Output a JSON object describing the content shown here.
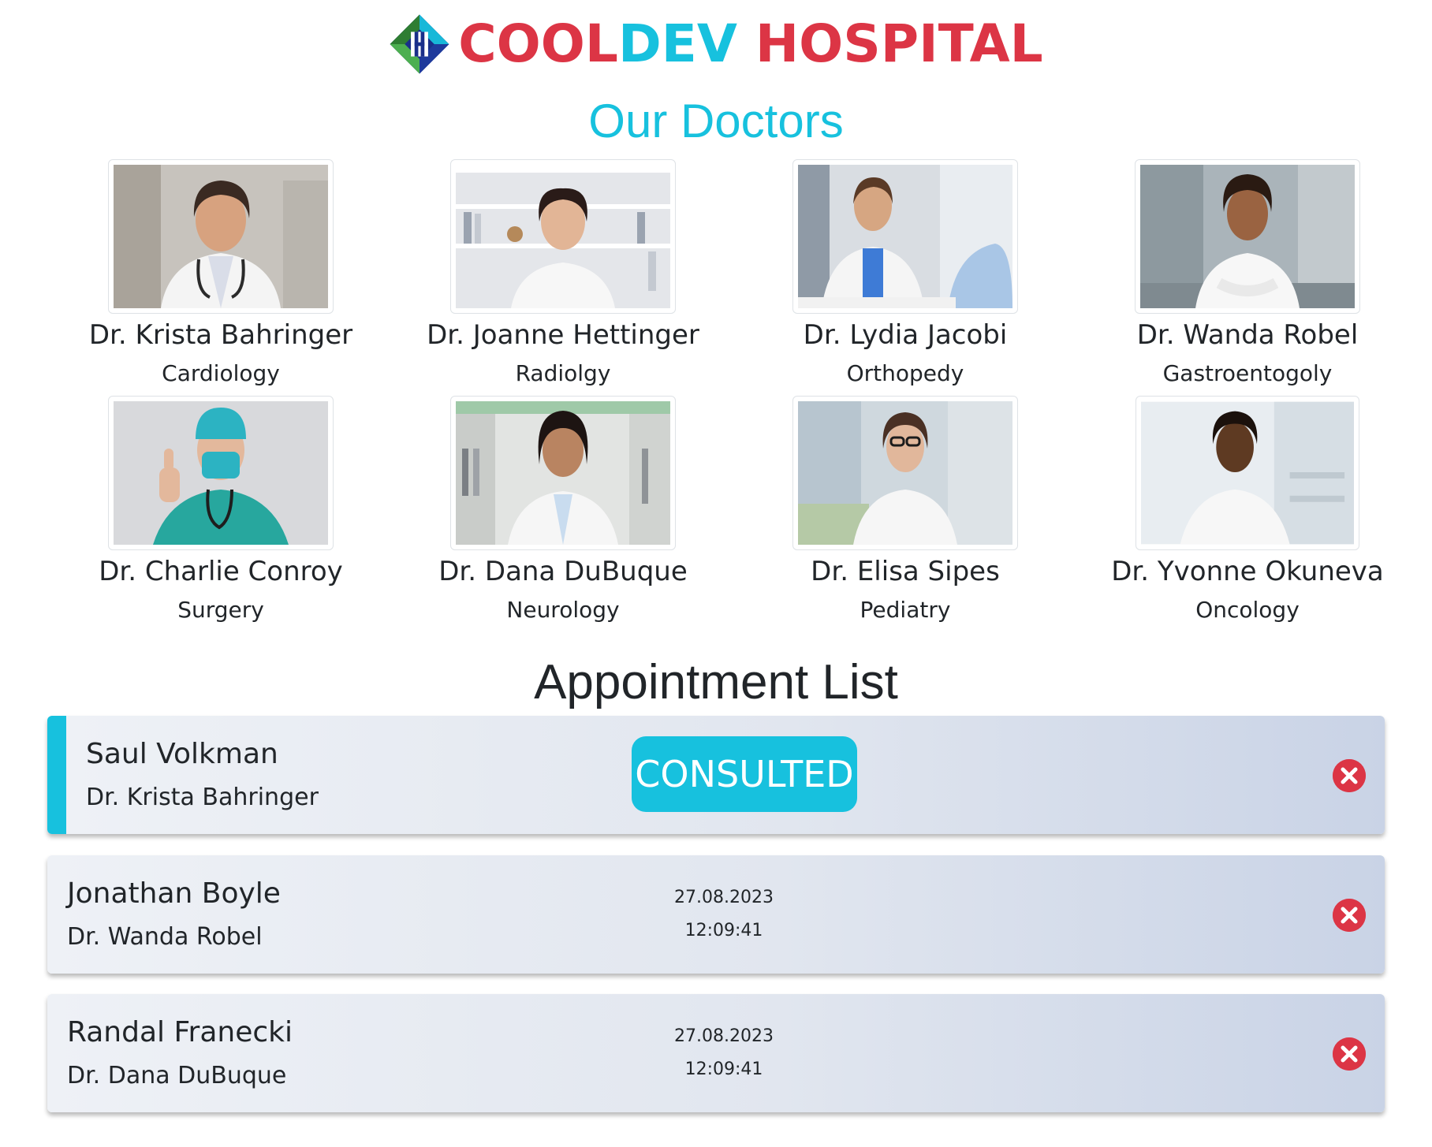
{
  "brand": {
    "part1": "COOL",
    "part2": "DEV",
    "part3": " HOSPITAL",
    "logo_icon": "hospital-logo-icon",
    "colors": {
      "red": "#dc3545",
      "cyan": "#17c1de"
    }
  },
  "doctors_section": {
    "title": "Our Doctors",
    "doctors": [
      {
        "name": "Dr. Krista Bahringer",
        "specialty": "Cardiology"
      },
      {
        "name": "Dr. Joanne Hettinger",
        "specialty": "Radiolgy"
      },
      {
        "name": "Dr. Lydia Jacobi",
        "specialty": "Orthopedy"
      },
      {
        "name": "Dr. Wanda Robel",
        "specialty": "Gastroentogoly"
      },
      {
        "name": "Dr. Charlie Conroy",
        "specialty": "Surgery"
      },
      {
        "name": "Dr. Dana DuBuque",
        "specialty": "Neurology"
      },
      {
        "name": "Dr. Elisa Sipes",
        "specialty": "Pediatry"
      },
      {
        "name": "Dr. Yvonne Okuneva",
        "specialty": "Oncology"
      }
    ]
  },
  "appointments_section": {
    "title": "Appointment List",
    "appointments": [
      {
        "patient": "Saul Volkman",
        "doctor": "Dr. Krista Bahringer",
        "status": "CONSULTED"
      },
      {
        "patient": "Jonathan Boyle",
        "doctor": "Dr. Wanda Robel",
        "date": "27.08.2023",
        "time": "12:09:41"
      },
      {
        "patient": "Randal Franecki",
        "doctor": "Dr. Dana DuBuque",
        "date": "27.08.2023",
        "time": "12:09:41"
      }
    ],
    "delete_icon": "close-circle-icon",
    "accent_color": "#17c1de",
    "delete_color": "#dc3545"
  }
}
